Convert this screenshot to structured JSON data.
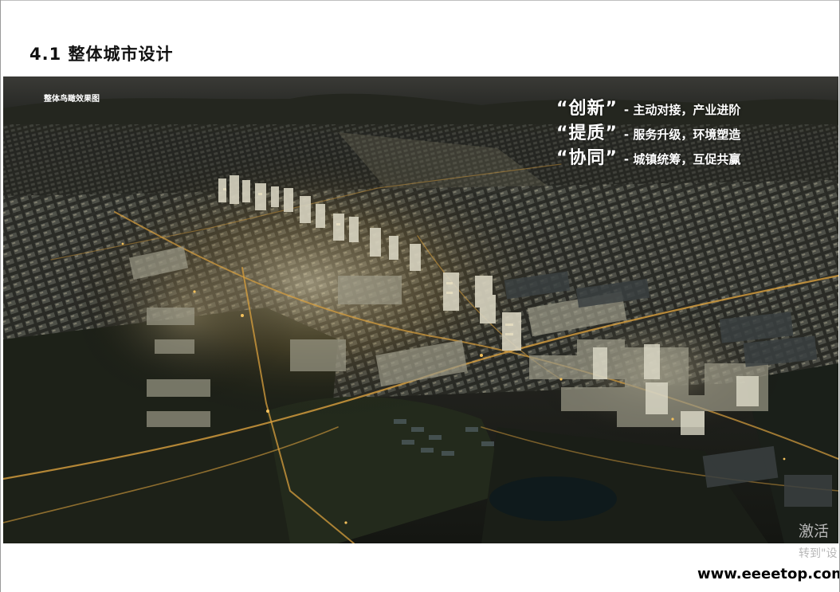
{
  "page": {
    "title": "4.1 整体城市设计"
  },
  "image": {
    "caption": "整体鸟瞰效果图",
    "slogans": [
      {
        "key": "“创新”",
        "desc": "- 主动对接，产业进阶"
      },
      {
        "key": "“提质”",
        "desc": "- 服务升级，环境塑造"
      },
      {
        "key": "“协同”",
        "desc": "- 城镇统筹，互促共赢"
      }
    ]
  },
  "watermark": {
    "line1": "激活",
    "line2": "转到\"设",
    "site": "www.eeeetop.com"
  }
}
